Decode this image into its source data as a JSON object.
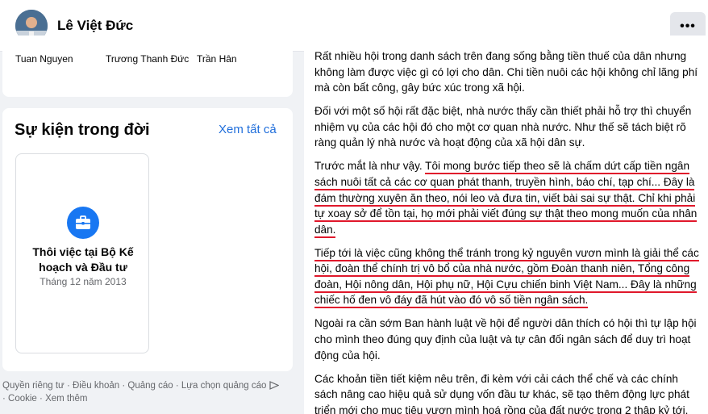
{
  "header": {
    "username": "Lê Việt Đức",
    "more_label": "•••"
  },
  "friends": [
    {
      "name": "Tuan Nguyen"
    },
    {
      "name": "Trương Thanh Đức"
    },
    {
      "name": "Trần Hân"
    }
  ],
  "events": {
    "title": "Sự kiện trong đời",
    "see_all": "Xem tất cả",
    "item": {
      "icon": "briefcase-icon",
      "title": "Thôi việc tại Bộ Kế hoạch và Đầu tư",
      "date": "Tháng 12 năm 2013"
    }
  },
  "footer": {
    "privacy": "Quyền riêng tư",
    "terms": "Điều khoản",
    "ads": "Quảng cáo",
    "ad_choices": "Lựa chọn quảng cáo",
    "cookie": "Cookie",
    "more": "Xem thêm"
  },
  "post": {
    "p1": "Rất nhiều hội trong danh sách trên đang sống bằng tiền thuế của dân nhưng không làm được việc gì có lợi cho dân. Chi tiền nuôi các hội không chỉ lãng phí mà còn bất công, gây bức xúc trong xã hội.",
    "p2": "Đối với một số hội rất đặc biệt, nhà nước thấy cần thiết phải hỗ trợ thì chuyển nhiệm vụ của các hội đó cho một cơ quan nhà nước. Như thế sẽ tách biệt rõ ràng quản lý nhà nước và hoạt động của xã hội dân sự.",
    "p3_prefix": "Trước mắt là như vậy. ",
    "p3_highlight": "Tôi mong bước tiếp theo sẽ là chấm dứt cấp tiền ngân sách nuôi tất cả các cơ quan phát thanh, truyền hình, báo chí, tạp chí... Đây là đám thường xuyên ăn theo, nói leo và đưa tin, viết bài sai sự thật. Chỉ khi phải tự xoay sở để tồn tại, họ mới phải viết đúng sự thật theo mong muốn của nhân dân.",
    "p4_highlight": "Tiếp tới là việc cũng không thể tránh trong kỷ nguyên vươn mình là giải thể các hội, đoàn thể chính trị vô bổ của nhà nước, gồm Đoàn thanh niên, Tổng công đoàn, Hội nông dân, Hội phụ nữ, Hội Cựu chiến binh Việt Nam... Đây là những chiếc hố đen vô đáy đã hút vào đó vô số tiền ngân sách.",
    "p5": "Ngoài ra cần sớm Ban hành luật về hội để người dân thích có hội thì tự lập hội cho mình theo đúng quy định của luật và tự cân đối ngân sách để duy trì hoạt động của hội.",
    "p6": "Các khoản tiền tiết kiệm nêu trên, đi kèm với cải cách thể chế và các chính sách nâng cao hiệu quả sử dụng vốn đầu tư khác, sẽ tạo thêm động lực phát triển mới cho mục tiêu vươn mình hoá rồng của đất nước trong 2 thập kỷ tới.",
    "highlight_color": "#e0182b"
  }
}
